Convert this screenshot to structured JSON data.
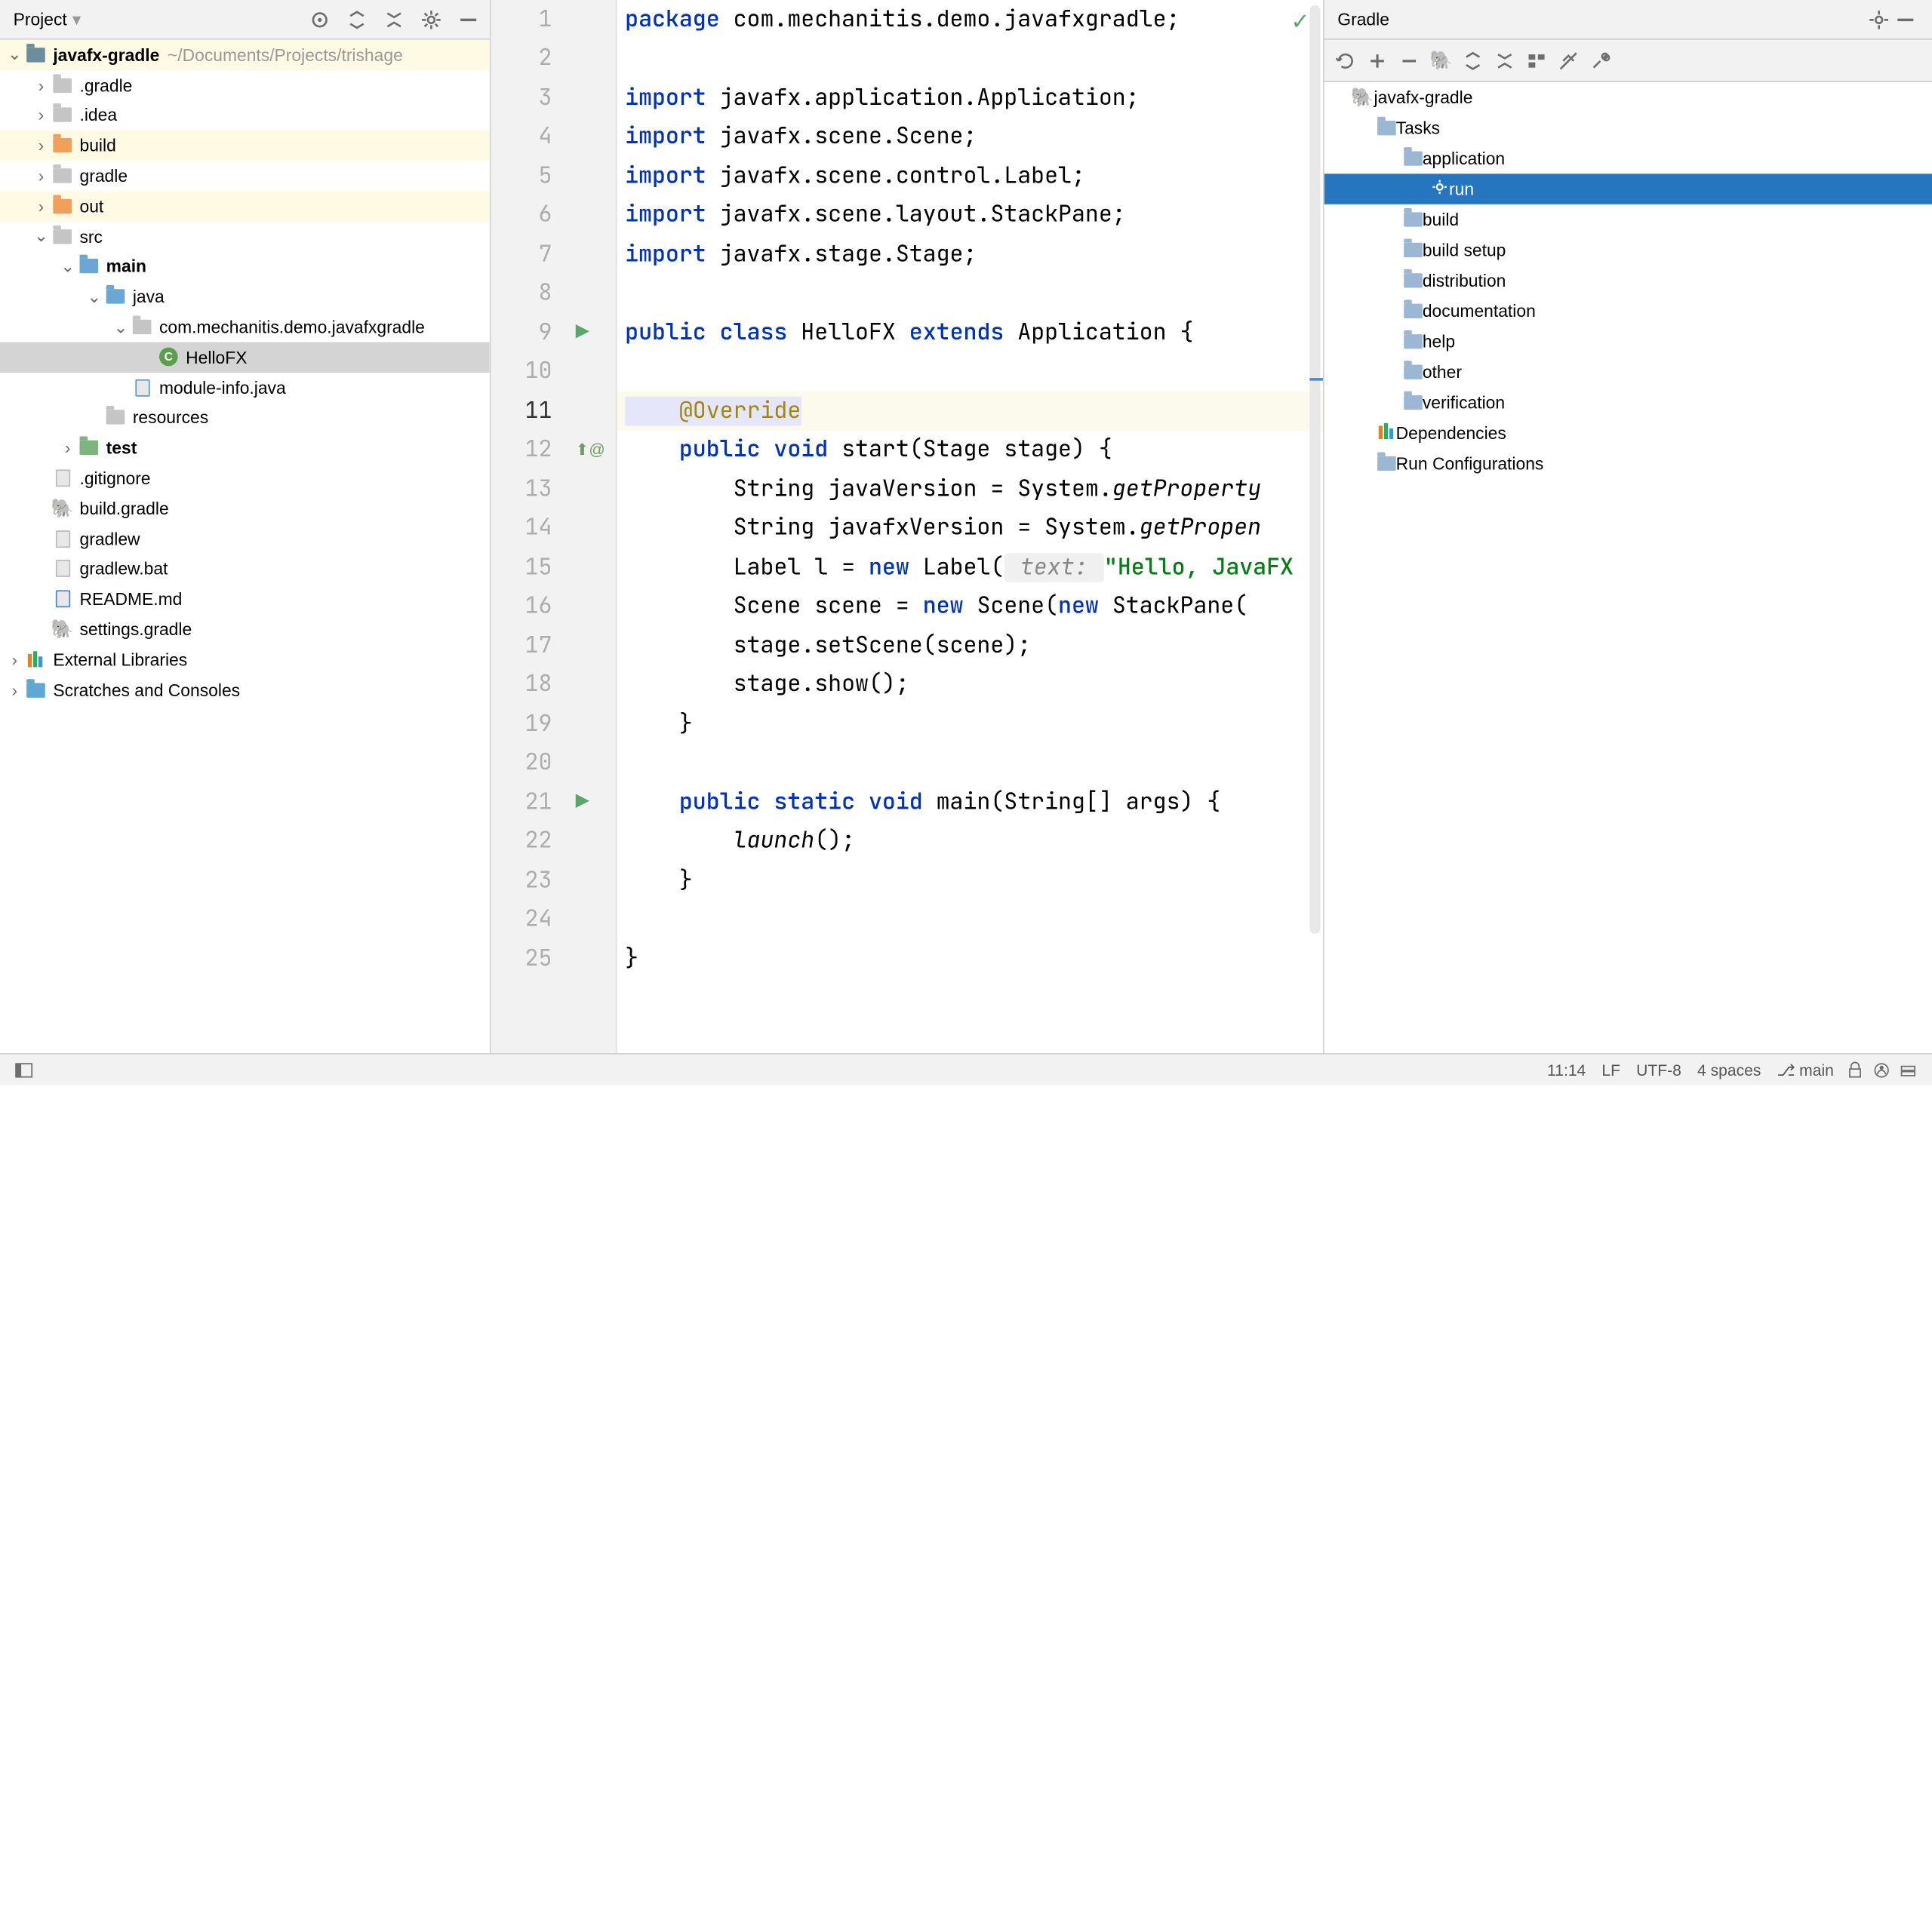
{
  "project_panel": {
    "title": "Project",
    "root": "javafx-gradle",
    "root_path": "~/Documents/Projects/trishage",
    "nodes": {
      "gradle_dir": ".gradle",
      "idea_dir": ".idea",
      "build": "build",
      "gradle": "gradle",
      "out": "out",
      "src": "src",
      "main": "main",
      "java": "java",
      "package": "com.mechanitis.demo.javafxgradle",
      "hellofx": "HelloFX",
      "module_info": "module-info.java",
      "resources": "resources",
      "test": "test",
      "gitignore": ".gitignore",
      "build_gradle": "build.gradle",
      "gradlew": "gradlew",
      "gradlew_bat": "gradlew.bat",
      "readme": "README.md",
      "settings_gradle": "settings.gradle",
      "ext_libs": "External Libraries",
      "scratches": "Scratches and Consoles"
    }
  },
  "editor": {
    "lines": {
      "l1a": "package",
      "l1b": " com.mechanitis.demo.javafxgradle;",
      "l3a": "import",
      "l3b": " javafx.application.Application;",
      "l4a": "import",
      "l4b": " javafx.scene.Scene;",
      "l5a": "import",
      "l5b": " javafx.scene.control.Label;",
      "l6a": "import",
      "l6b": " javafx.scene.layout.StackPane;",
      "l7a": "import",
      "l7b": " javafx.stage.Stage;",
      "l9a": "public class",
      "l9b": " HelloFX ",
      "l9c": "extends",
      "l9d": " Application {",
      "l11": "    @Override",
      "l12a": "    public void",
      "l12b": " start(Stage stage) {",
      "l13a": "        String javaVersion = System.",
      "l13b": "getProperty",
      "l14a": "        String javafxVersion = System.",
      "l14b": "getPropen",
      "l15a": "        Label l = ",
      "l15b": "new",
      "l15c": " Label(",
      "l15hint": " text: ",
      "l15d": "\"Hello, JavaFX",
      "l16a": "        Scene scene = ",
      "l16b": "new",
      "l16c": " Scene(",
      "l16d": "new",
      "l16e": " StackPane(",
      "l17": "        stage.setScene(scene);",
      "l18": "        stage.show();",
      "l19": "    }",
      "l21a": "    public static void",
      "l21b": " main(String[] args) {",
      "l22a": "        ",
      "l22b": "launch",
      "l22c": "();",
      "l23": "    }",
      "l25": "}"
    },
    "numbers": [
      "1",
      "2",
      "3",
      "4",
      "5",
      "6",
      "7",
      "8",
      "9",
      "10",
      "11",
      "12",
      "13",
      "14",
      "15",
      "16",
      "17",
      "18",
      "19",
      "20",
      "21",
      "22",
      "23",
      "24",
      "25"
    ]
  },
  "gradle_panel": {
    "title": "Gradle",
    "root": "javafx-gradle",
    "tasks_label": "Tasks",
    "groups": {
      "application": "application",
      "run": "run",
      "build": "build",
      "build_setup": "build setup",
      "distribution": "distribution",
      "documentation": "documentation",
      "help": "help",
      "other": "other",
      "verification": "verification"
    },
    "dependencies": "Dependencies",
    "run_configs": "Run Configurations"
  },
  "status": {
    "position": "11:14",
    "line_sep": "LF",
    "encoding": "UTF-8",
    "indent": "4 spaces",
    "branch": "main"
  }
}
